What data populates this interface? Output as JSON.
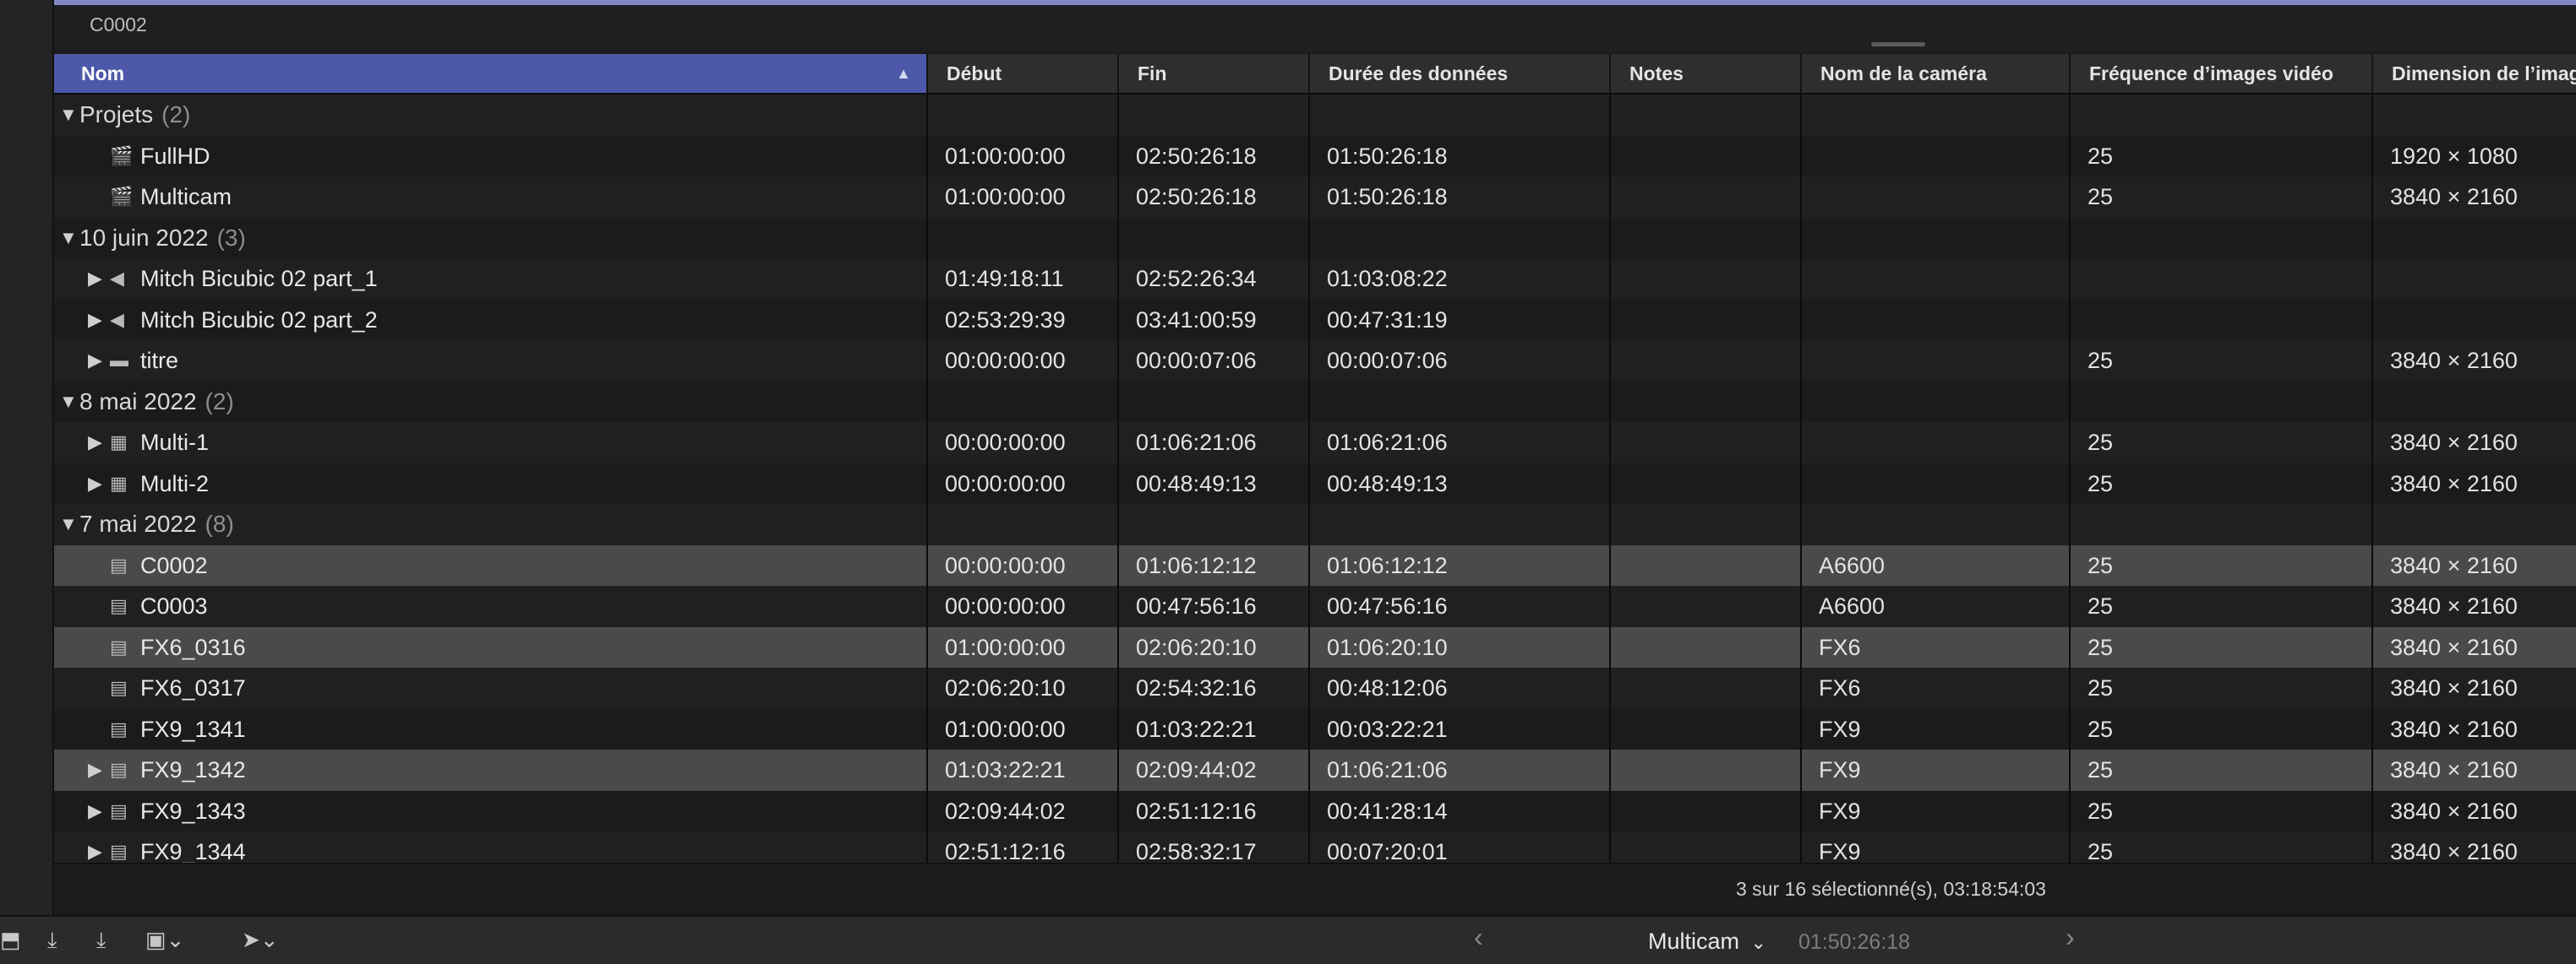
{
  "top": {
    "clip_name": "C0002"
  },
  "columns": [
    {
      "label": "Nom",
      "sort": "▲"
    },
    {
      "label": "Début"
    },
    {
      "label": "Fin"
    },
    {
      "label": "Durée des données"
    },
    {
      "label": "Notes"
    },
    {
      "label": "Nom de la caméra"
    },
    {
      "label": "Fréquence d’images vidéo"
    },
    {
      "label": "Dimension de l’image"
    }
  ],
  "rows": [
    {
      "type": "group",
      "name": "Projets",
      "count": "(2)"
    },
    {
      "type": "item",
      "icon": "🎬",
      "icon_name": "project-clapper-icon",
      "name": "FullHD",
      "start": "01:00:00:00",
      "end": "02:50:26:18",
      "duration": "01:50:26:18",
      "notes": "",
      "camera": "",
      "fps": "25",
      "dim": "1920 × 1080"
    },
    {
      "type": "item",
      "icon": "🎬",
      "icon_name": "project-clapper-icon",
      "name": "Multicam",
      "start": "01:00:00:00",
      "end": "02:50:26:18",
      "duration": "01:50:26:18",
      "notes": "",
      "camera": "",
      "fps": "25",
      "dim": "3840 × 2160"
    },
    {
      "type": "group",
      "name": "10 juin 2022",
      "count": "(3)"
    },
    {
      "type": "item",
      "disclosure": "▶",
      "icon": "◀",
      "icon_name": "audio-speaker-icon",
      "name": "Mitch Bicubic 02 part_1",
      "start": "01:49:18:11",
      "end": "02:52:26:34",
      "duration": "01:03:08:22",
      "notes": "",
      "camera": "",
      "fps": "",
      "dim": ""
    },
    {
      "type": "item",
      "disclosure": "▶",
      "icon": "◀",
      "icon_name": "audio-speaker-icon",
      "name": "Mitch Bicubic 02 part_2",
      "start": "02:53:29:39",
      "end": "03:41:00:59",
      "duration": "00:47:31:19",
      "notes": "",
      "camera": "",
      "fps": "",
      "dim": ""
    },
    {
      "type": "item",
      "disclosure": "▶",
      "icon": "▬",
      "icon_name": "title-clip-icon",
      "name": "titre",
      "start": "00:00:00:00",
      "end": "00:00:07:06",
      "duration": "00:00:07:06",
      "notes": "",
      "camera": "",
      "fps": "25",
      "dim": "3840 × 2160"
    },
    {
      "type": "group",
      "name": "8 mai 2022",
      "count": "(2)"
    },
    {
      "type": "item",
      "disclosure": "▶",
      "icon": "▦",
      "icon_name": "multicam-clip-icon",
      "name": "Multi-1",
      "start": "00:00:00:00",
      "end": "01:06:21:06",
      "duration": "01:06:21:06",
      "notes": "",
      "camera": "",
      "fps": "25",
      "dim": "3840 × 2160"
    },
    {
      "type": "item",
      "disclosure": "▶",
      "icon": "▦",
      "icon_name": "multicam-clip-icon",
      "name": "Multi-2",
      "start": "00:00:00:00",
      "end": "00:48:49:13",
      "duration": "00:48:49:13",
      "notes": "",
      "camera": "",
      "fps": "25",
      "dim": "3840 × 2160"
    },
    {
      "type": "group",
      "name": "7 mai 2022",
      "count": "(8)"
    },
    {
      "type": "item",
      "selected": true,
      "icon": "▤",
      "icon_name": "film-clip-icon",
      "name": "C0002",
      "start": "00:00:00:00",
      "end": "01:06:12:12",
      "duration": "01:06:12:12",
      "notes": "",
      "camera": "A6600",
      "fps": "25",
      "dim": "3840 × 2160"
    },
    {
      "type": "item",
      "icon": "▤",
      "icon_name": "film-clip-icon",
      "name": "C0003",
      "start": "00:00:00:00",
      "end": "00:47:56:16",
      "duration": "00:47:56:16",
      "notes": "",
      "camera": "A6600",
      "fps": "25",
      "dim": "3840 × 2160"
    },
    {
      "type": "item",
      "selected": true,
      "icon": "▤",
      "icon_name": "film-clip-icon",
      "name": "FX6_0316",
      "start": "01:00:00:00",
      "end": "02:06:20:10",
      "duration": "01:06:20:10",
      "notes": "",
      "camera": "FX6",
      "fps": "25",
      "dim": "3840 × 2160"
    },
    {
      "type": "item",
      "icon": "▤",
      "icon_name": "film-clip-icon",
      "name": "FX6_0317",
      "start": "02:06:20:10",
      "end": "02:54:32:16",
      "duration": "00:48:12:06",
      "notes": "",
      "camera": "FX6",
      "fps": "25",
      "dim": "3840 × 2160"
    },
    {
      "type": "item",
      "icon": "▤",
      "icon_name": "film-clip-icon",
      "name": "FX9_1341",
      "start": "01:00:00:00",
      "end": "01:03:22:21",
      "duration": "00:03:22:21",
      "notes": "",
      "camera": "FX9",
      "fps": "25",
      "dim": "3840 × 2160"
    },
    {
      "type": "item",
      "selected": true,
      "disclosure": "▶",
      "icon": "▤",
      "icon_name": "film-clip-icon",
      "name": "FX9_1342",
      "start": "01:03:22:21",
      "end": "02:09:44:02",
      "duration": "01:06:21:06",
      "notes": "",
      "camera": "FX9",
      "fps": "25",
      "dim": "3840 × 2160"
    },
    {
      "type": "item",
      "disclosure": "▶",
      "icon": "▤",
      "icon_name": "film-clip-icon",
      "name": "FX9_1343",
      "start": "02:09:44:02",
      "end": "02:51:12:16",
      "duration": "00:41:28:14",
      "notes": "",
      "camera": "FX9",
      "fps": "25",
      "dim": "3840 × 2160"
    },
    {
      "type": "item",
      "disclosure": "▶",
      "icon": "▤",
      "icon_name": "film-clip-icon",
      "name": "FX9_1344",
      "start": "02:51:12:16",
      "end": "02:58:32:17",
      "duration": "00:07:20:01",
      "notes": "",
      "camera": "FX9",
      "fps": "25",
      "dim": "3840 × 2160"
    }
  ],
  "status": {
    "text": "3 sur 16 sélectionné(s), 03:18:54:03"
  },
  "bottom": {
    "project_name": "Multicam",
    "project_chevron": "⌄",
    "timecode": "01:50:26:18",
    "prev_arrow": "‹",
    "next_arrow": "›",
    "tools": [
      "⬒",
      "⤓",
      "⤓",
      "▣⌄",
      "➤⌄"
    ]
  }
}
